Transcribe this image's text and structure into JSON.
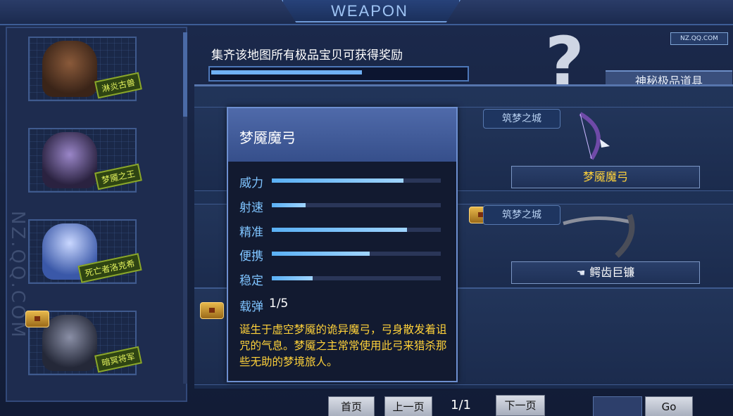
{
  "header": {
    "title": "WEAPON"
  },
  "badge": "NZ.QQ.COM",
  "watermark": "NZ.QQ.COM",
  "sidebar": {
    "bosses": [
      {
        "label": "淋炎古兽"
      },
      {
        "label": "梦魇之王"
      },
      {
        "label": "死亡者洛克希"
      },
      {
        "label": "暗冥将军"
      }
    ]
  },
  "collection": {
    "text": "集齐该地图所有极品宝贝可获得奖励",
    "progress": 0.6,
    "mystery_label": "神秘极品道具",
    "mystery_icon": "question-mark-icon"
  },
  "weapons": [
    {
      "map": "筑梦之城",
      "name": "梦魇魔弓",
      "name_color": "#ffd23a"
    },
    {
      "map": "筑梦之城",
      "name": "鳄齿巨镰",
      "name_color": "#ffffff"
    }
  ],
  "tooltip": {
    "title": "梦魇魔弓",
    "stats": [
      {
        "label": "威力",
        "value": 0.78
      },
      {
        "label": "射速",
        "value": 0.2
      },
      {
        "label": "精准",
        "value": 0.8
      },
      {
        "label": "便携",
        "value": 0.58
      },
      {
        "label": "稳定",
        "value": 0.24
      }
    ],
    "ammo_label": "载弹",
    "ammo_value": "1/5",
    "description": "诞生于虚空梦魇的诡异魔弓，弓身散发着诅咒的气息。梦魇之主常常使用此弓来猎杀那些无助的梦境旅人。"
  },
  "pagination": {
    "first": "首页",
    "prev": "上一页",
    "indicator": "1/1",
    "next": "下一页",
    "go": "Go"
  }
}
